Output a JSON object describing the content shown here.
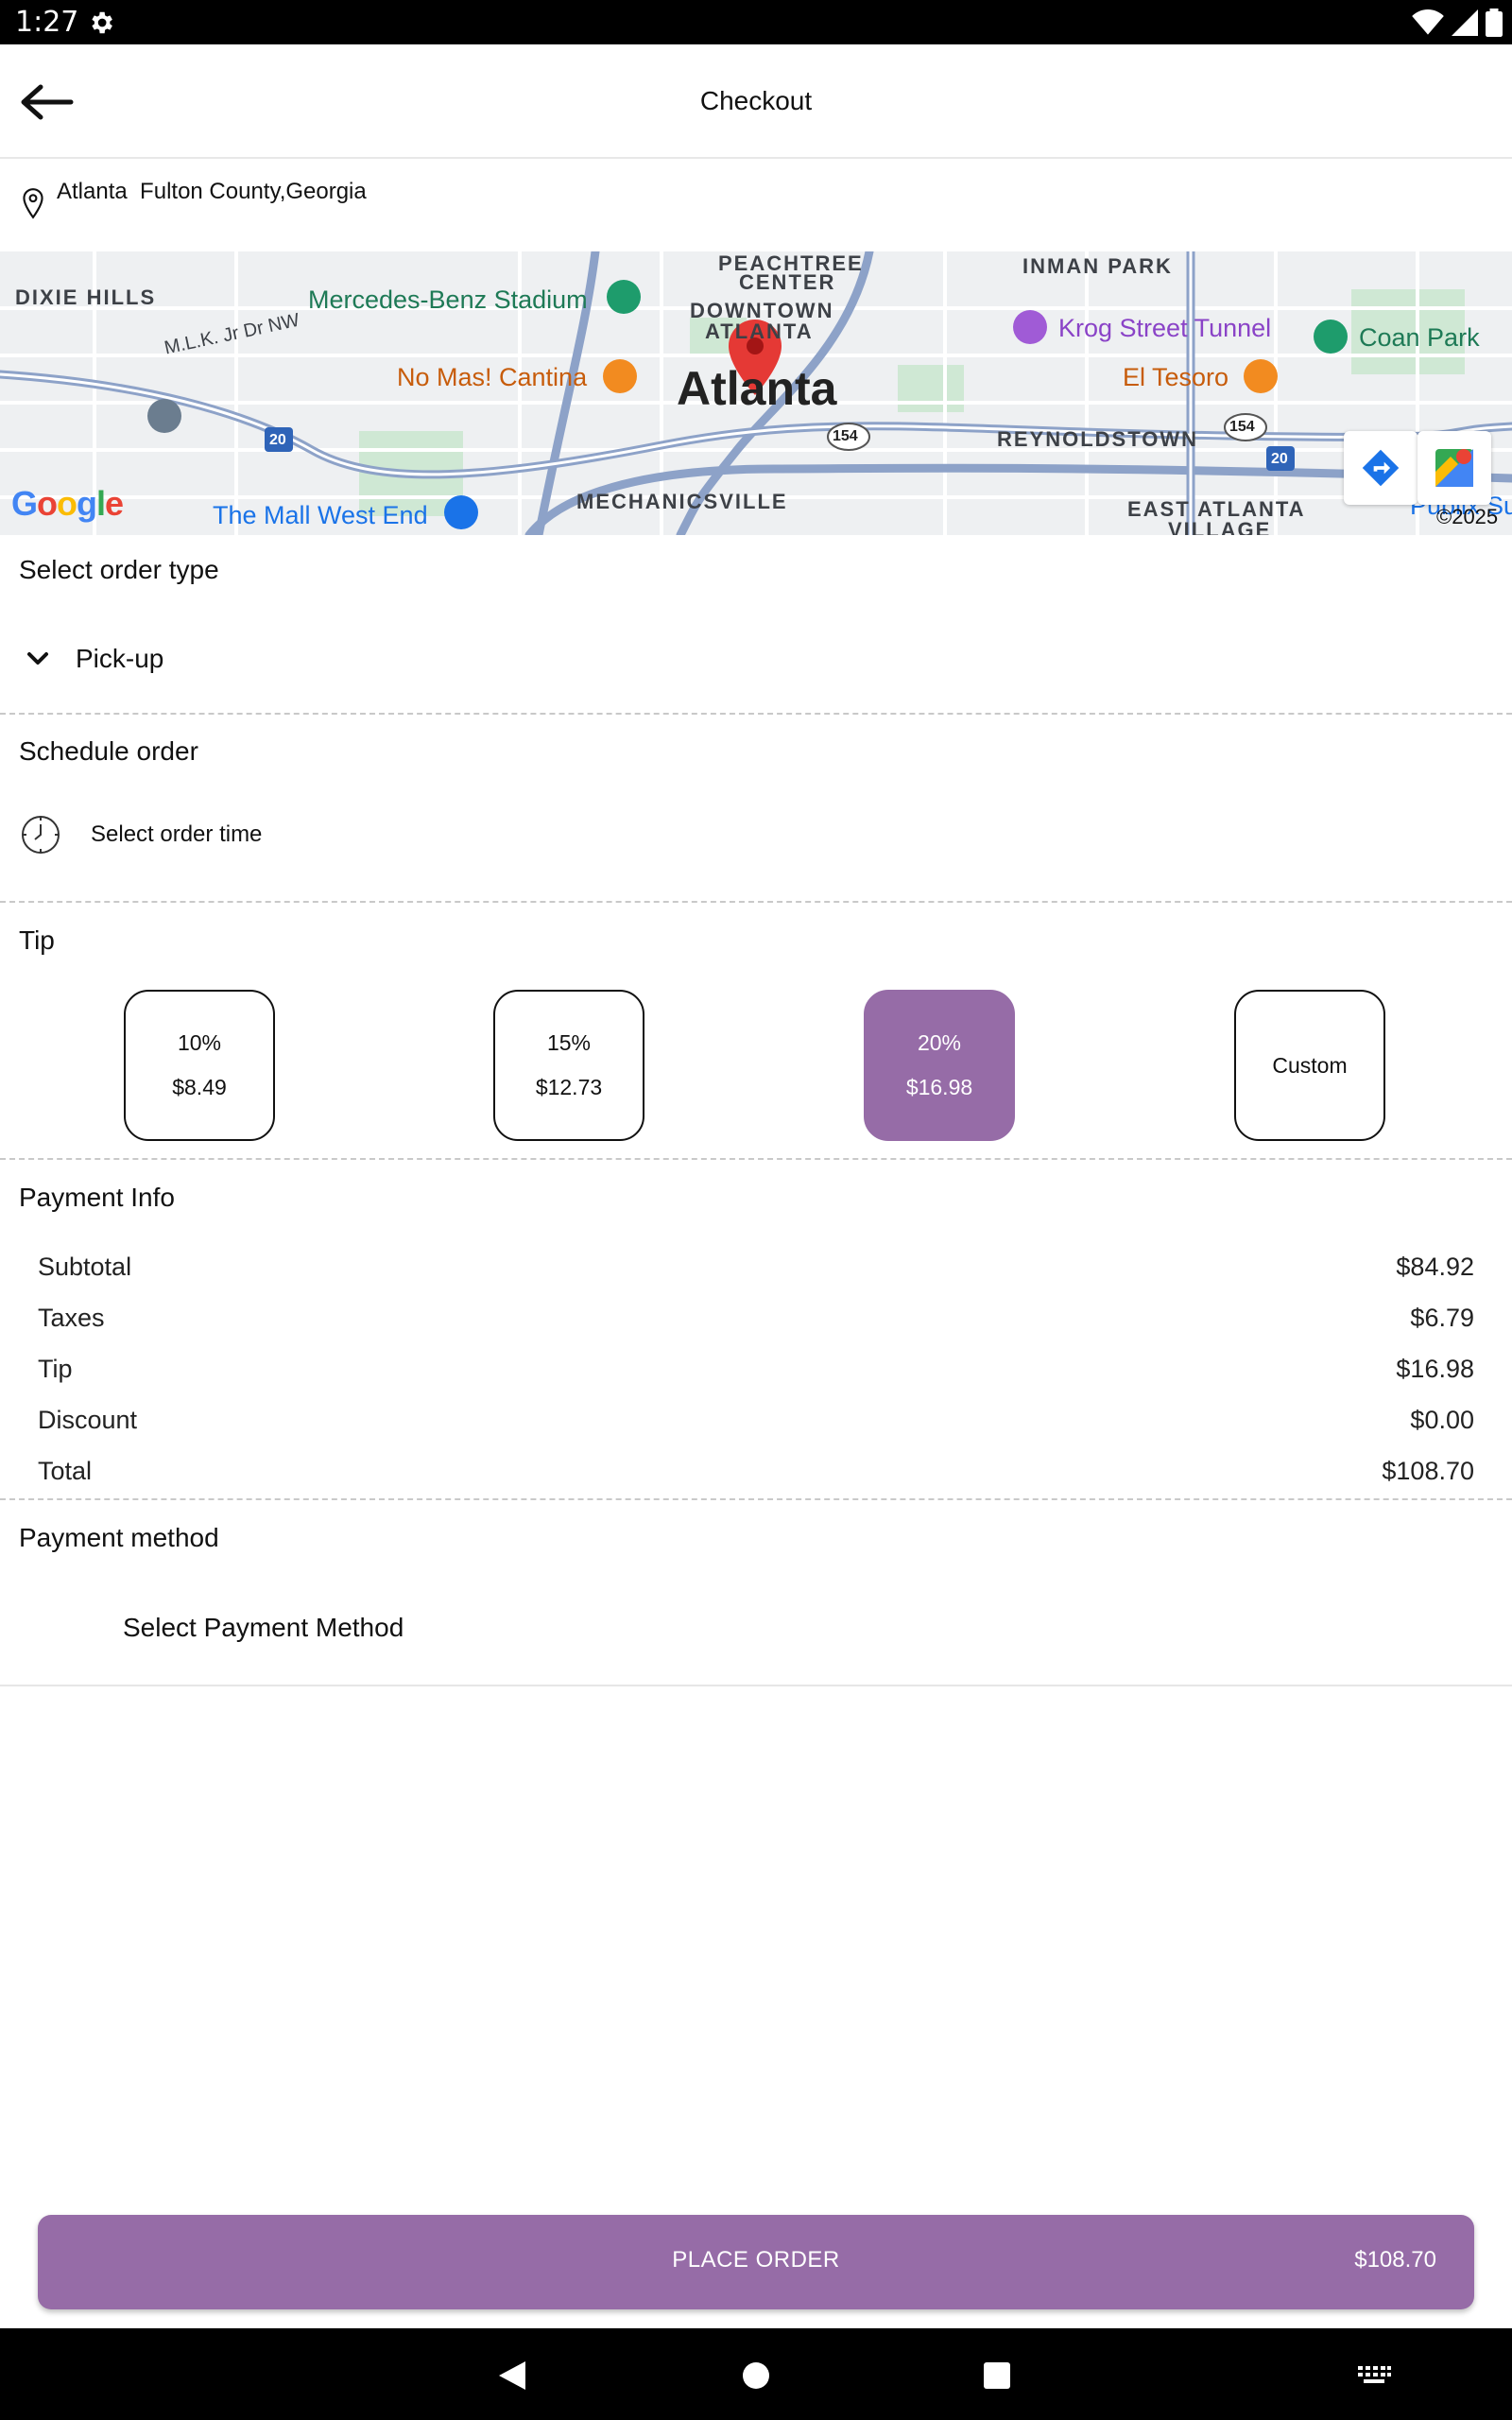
{
  "status_bar": {
    "time": "1:27",
    "icons": [
      "gear-icon",
      "wifi-icon",
      "signal-icon",
      "battery-icon"
    ]
  },
  "app_bar": {
    "title": "Checkout",
    "back_icon": "arrow-left-icon"
  },
  "location": {
    "icon": "map-pin-icon",
    "address": "Atlanta  Fulton County,Georgia"
  },
  "map": {
    "city_label": "Atlanta",
    "labels": {
      "peachtree": "PEACHTREE",
      "center": "CENTER",
      "downtown": "DOWNTOWN",
      "atlanta_small": "ATLANTA",
      "inman_park": "INMAN PARK",
      "dixie_hills": "DIXIE HILLS",
      "reynoldstown": "REYNOLDSTOWN",
      "mechanicsville": "MECHANICSVILLE",
      "east_atlanta": "EAST ATLANTA",
      "village": "VILLAGE",
      "mlk": "M.L.K. Jr Dr NW",
      "stadium": "Mercedes-Benz Stadium",
      "krog": "Krog Street Tunnel",
      "coan_park": "Coan Park",
      "no_mas": "No Mas! Cantina",
      "el_tesoro": "El Tesoro",
      "mall": "The Mall West End",
      "publix": "Publix Su",
      "route_20": "20",
      "route_154": "154"
    },
    "google_logo": "Google",
    "copyright": "©2025"
  },
  "order_type": {
    "title": "Select order type",
    "selected": "Pick-up"
  },
  "schedule": {
    "title": "Schedule order",
    "placeholder": "Select order time"
  },
  "tip": {
    "title": "Tip",
    "options": [
      {
        "percent": "10%",
        "amount": "$8.49",
        "selected": false
      },
      {
        "percent": "15%",
        "amount": "$12.73",
        "selected": false
      },
      {
        "percent": "20%",
        "amount": "$16.98",
        "selected": true
      },
      {
        "label": "Custom",
        "selected": false
      }
    ]
  },
  "payment_info": {
    "title": "Payment Info",
    "rows": [
      {
        "label": "Subtotal",
        "value": "$84.92"
      },
      {
        "label": "Taxes",
        "value": "$6.79"
      },
      {
        "label": "Tip",
        "value": "$16.98"
      },
      {
        "label": "Discount",
        "value": "$0.00"
      },
      {
        "label": "Total",
        "value": "$108.70"
      }
    ]
  },
  "payment_method": {
    "title": "Payment method",
    "placeholder": "Select Payment Method"
  },
  "place_order": {
    "label": "PLACE ORDER",
    "amount": "$108.70"
  },
  "colors": {
    "accent": "#966ca7",
    "divider": "#c9c9c9"
  }
}
